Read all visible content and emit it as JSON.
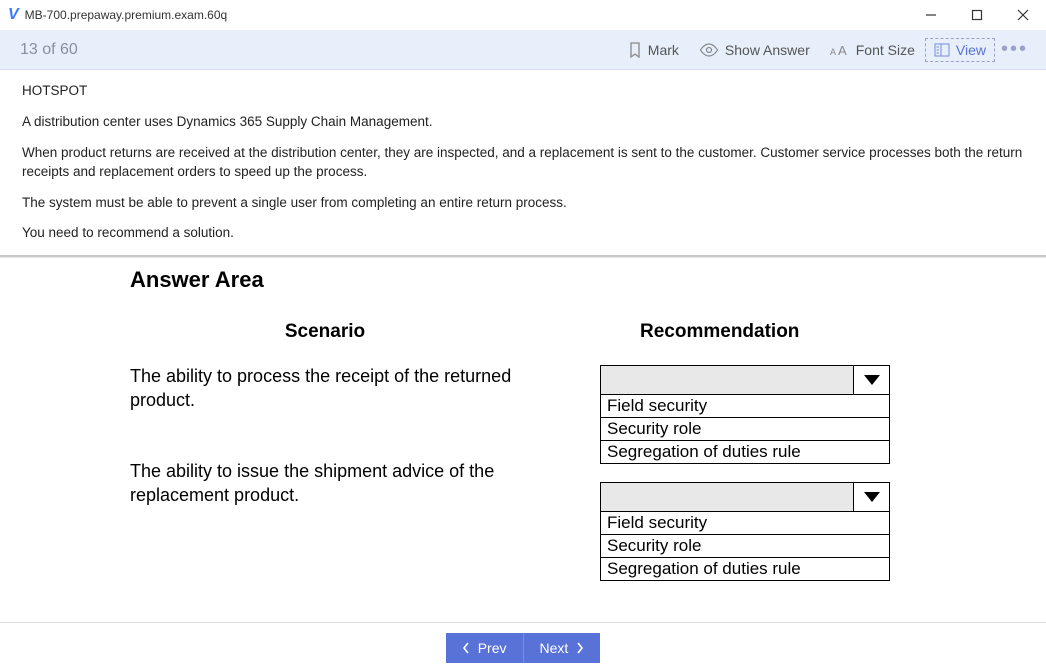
{
  "window": {
    "title": "MB-700.prepaway.premium.exam.60q"
  },
  "toolbar": {
    "counter": "13 of 60",
    "mark": "Mark",
    "show_answer": "Show Answer",
    "font_size": "Font Size",
    "view": "View"
  },
  "question": {
    "type": "HOTSPOT",
    "p1": "A distribution center uses Dynamics 365 Supply Chain Management.",
    "p2": "When product returns are received at the distribution center, they are inspected, and a replacement is sent to the customer. Customer service processes both the return receipts and replacement orders to speed up the process.",
    "p3": "The system must be able to prevent a single user from completing an entire return process.",
    "p4": "You need to recommend a solution."
  },
  "answer": {
    "heading": "Answer Area",
    "col_scenario": "Scenario",
    "col_reco": "Recommendation",
    "rows": [
      {
        "scenario": "The ability to process the receipt of the returned product.",
        "options": [
          "Field security",
          "Security role",
          "Segregation of duties rule"
        ]
      },
      {
        "scenario": "The ability to issue the shipment advice of the replacement product.",
        "options": [
          "Field security",
          "Security role",
          "Segregation of duties rule"
        ]
      }
    ]
  },
  "nav": {
    "prev": "Prev",
    "next": "Next"
  }
}
